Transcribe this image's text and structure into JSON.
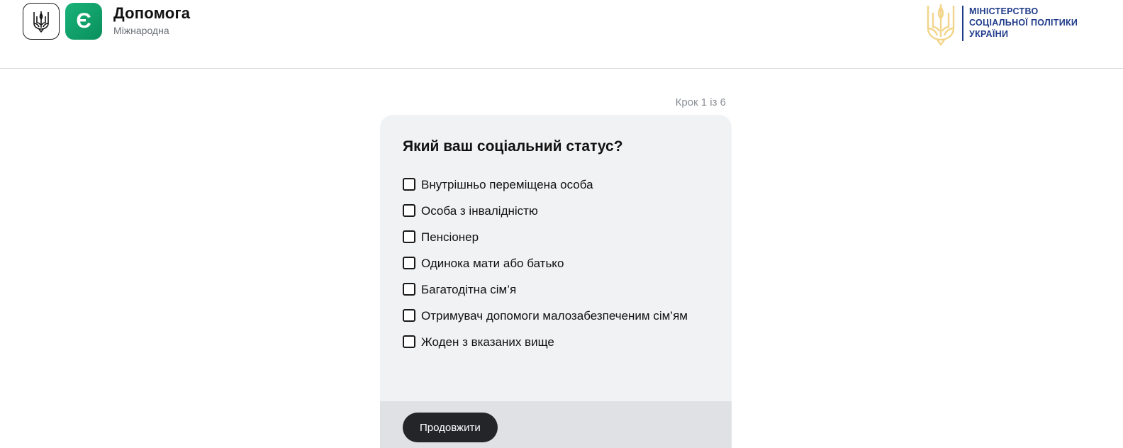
{
  "header": {
    "brand_title": "Допомога",
    "brand_subtitle": "Міжнародна",
    "app_icon_letter": "Є",
    "ministry_lines": [
      "МІНІСТЕРСТВО",
      "СОЦІАЛЬНОЇ ПОЛІТИКИ",
      "УКРАЇНИ"
    ],
    "icons": [
      "trident-icon",
      "app-e-icon",
      "ministry-trident-icon"
    ]
  },
  "form": {
    "step_indicator": "Крок 1 із 6",
    "question": "Який ваш соціальний статус?",
    "options": [
      {
        "label": "Внутрішньо переміщена особа",
        "checked": false
      },
      {
        "label": "Особа з інвалідністю",
        "checked": false
      },
      {
        "label": "Пенсіонер",
        "checked": false
      },
      {
        "label": "Одинока мати або батько",
        "checked": false
      },
      {
        "label": "Багатодітна сім’я",
        "checked": false
      },
      {
        "label": "Отримувач допомоги малозабезпеченим сім’ям",
        "checked": false
      },
      {
        "label": "Жоден з вказаних вище",
        "checked": false
      }
    ],
    "continue_label": "Продовжити"
  },
  "colors": {
    "brand_green": "#12a36c",
    "ministry_blue": "#1f3b8a",
    "ministry_gold": "#f2d58a",
    "card_bg": "#f1f2f4",
    "footer_bg": "#dfe1e5",
    "button_bg": "#232528"
  }
}
